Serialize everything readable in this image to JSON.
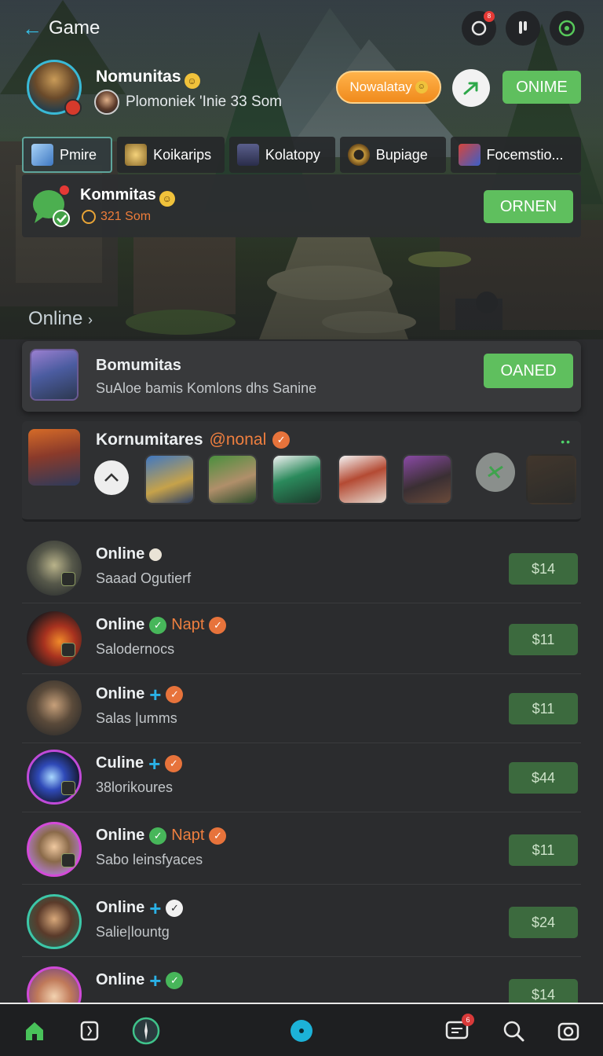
{
  "header": {
    "title": "Game"
  },
  "top_icons": [
    {
      "icon": "refresh-icon",
      "badge": "8"
    },
    {
      "icon": "microphone-icon"
    },
    {
      "icon": "target-icon"
    }
  ],
  "profile": {
    "name": "Nomunitas",
    "subtitle": "Plomoniek 'Inie 33 Som",
    "action_pill": "Nowalatay",
    "online_button": "ONIМE"
  },
  "tabs": [
    {
      "label": "Pmire",
      "icon": "cube-icon",
      "active": true
    },
    {
      "label": "Koikarips",
      "icon": "star-icon"
    },
    {
      "label": "Kolatopy",
      "icon": "flask-icon"
    },
    {
      "label": "Bupiage",
      "icon": "ring-icon"
    },
    {
      "label": "Focemstio...",
      "icon": "gear-icon"
    }
  ],
  "community": {
    "title": "Kommitas",
    "sub": "321 Som",
    "button": "ORNEN"
  },
  "online_link": "Online",
  "featured": {
    "title": "Bomumitas",
    "subtitle": "SuAloe bamis Komlons dhs Sanine",
    "button": "OANED"
  },
  "community2": {
    "title": "Kornumitares",
    "tag": "@nonal"
  },
  "list": [
    {
      "title": "Online",
      "sub": "Saaad Ogutierf",
      "price": "$14",
      "tag": "",
      "icon": "dot"
    },
    {
      "title": "Online",
      "sub": "Salodernocs",
      "price": "$11",
      "tag": "Napt",
      "icon": "check"
    },
    {
      "title": "Online",
      "sub": "Salas |umms",
      "price": "$11",
      "tag": "",
      "icon": "plus"
    },
    {
      "title": "Culine",
      "sub": "38lorikoures",
      "price": "$44",
      "tag": "",
      "icon": "plus"
    },
    {
      "title": "Online",
      "sub": "Sabo leinsfyaces",
      "price": "$11",
      "tag": "Napt",
      "icon": "check"
    },
    {
      "title": "Online",
      "sub": "Salie|lountg",
      "price": "$24",
      "tag": "",
      "icon": "plus-white"
    },
    {
      "title": "Online",
      "sub": "",
      "price": "$14",
      "tag": "",
      "icon": "plus-green"
    }
  ],
  "bottom_nav": [
    {
      "icon": "home-icon",
      "active": true
    },
    {
      "icon": "card-icon"
    },
    {
      "icon": "compass-icon"
    },
    {
      "icon": "center-dot-icon"
    },
    {
      "icon": "chat-icon",
      "badge": "6"
    },
    {
      "icon": "search-icon"
    },
    {
      "icon": "camera-icon"
    }
  ],
  "colors": {
    "accent": "#35c2e8",
    "green": "#5fbf5e",
    "orange": "#ef7f3f",
    "price_bg": "#3c6a3e"
  }
}
